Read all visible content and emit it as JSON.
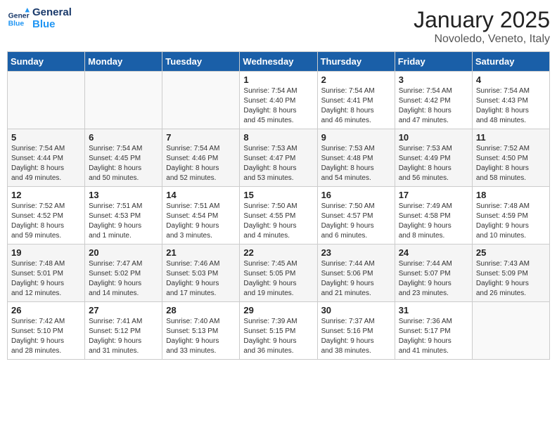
{
  "header": {
    "logo_line1": "General",
    "logo_line2": "Blue",
    "month": "January 2025",
    "location": "Novoledo, Veneto, Italy"
  },
  "weekdays": [
    "Sunday",
    "Monday",
    "Tuesday",
    "Wednesday",
    "Thursday",
    "Friday",
    "Saturday"
  ],
  "weeks": [
    [
      {
        "day": "",
        "info": ""
      },
      {
        "day": "",
        "info": ""
      },
      {
        "day": "",
        "info": ""
      },
      {
        "day": "1",
        "info": "Sunrise: 7:54 AM\nSunset: 4:40 PM\nDaylight: 8 hours\nand 45 minutes."
      },
      {
        "day": "2",
        "info": "Sunrise: 7:54 AM\nSunset: 4:41 PM\nDaylight: 8 hours\nand 46 minutes."
      },
      {
        "day": "3",
        "info": "Sunrise: 7:54 AM\nSunset: 4:42 PM\nDaylight: 8 hours\nand 47 minutes."
      },
      {
        "day": "4",
        "info": "Sunrise: 7:54 AM\nSunset: 4:43 PM\nDaylight: 8 hours\nand 48 minutes."
      }
    ],
    [
      {
        "day": "5",
        "info": "Sunrise: 7:54 AM\nSunset: 4:44 PM\nDaylight: 8 hours\nand 49 minutes."
      },
      {
        "day": "6",
        "info": "Sunrise: 7:54 AM\nSunset: 4:45 PM\nDaylight: 8 hours\nand 50 minutes."
      },
      {
        "day": "7",
        "info": "Sunrise: 7:54 AM\nSunset: 4:46 PM\nDaylight: 8 hours\nand 52 minutes."
      },
      {
        "day": "8",
        "info": "Sunrise: 7:53 AM\nSunset: 4:47 PM\nDaylight: 8 hours\nand 53 minutes."
      },
      {
        "day": "9",
        "info": "Sunrise: 7:53 AM\nSunset: 4:48 PM\nDaylight: 8 hours\nand 54 minutes."
      },
      {
        "day": "10",
        "info": "Sunrise: 7:53 AM\nSunset: 4:49 PM\nDaylight: 8 hours\nand 56 minutes."
      },
      {
        "day": "11",
        "info": "Sunrise: 7:52 AM\nSunset: 4:50 PM\nDaylight: 8 hours\nand 58 minutes."
      }
    ],
    [
      {
        "day": "12",
        "info": "Sunrise: 7:52 AM\nSunset: 4:52 PM\nDaylight: 8 hours\nand 59 minutes."
      },
      {
        "day": "13",
        "info": "Sunrise: 7:51 AM\nSunset: 4:53 PM\nDaylight: 9 hours\nand 1 minute."
      },
      {
        "day": "14",
        "info": "Sunrise: 7:51 AM\nSunset: 4:54 PM\nDaylight: 9 hours\nand 3 minutes."
      },
      {
        "day": "15",
        "info": "Sunrise: 7:50 AM\nSunset: 4:55 PM\nDaylight: 9 hours\nand 4 minutes."
      },
      {
        "day": "16",
        "info": "Sunrise: 7:50 AM\nSunset: 4:57 PM\nDaylight: 9 hours\nand 6 minutes."
      },
      {
        "day": "17",
        "info": "Sunrise: 7:49 AM\nSunset: 4:58 PM\nDaylight: 9 hours\nand 8 minutes."
      },
      {
        "day": "18",
        "info": "Sunrise: 7:48 AM\nSunset: 4:59 PM\nDaylight: 9 hours\nand 10 minutes."
      }
    ],
    [
      {
        "day": "19",
        "info": "Sunrise: 7:48 AM\nSunset: 5:01 PM\nDaylight: 9 hours\nand 12 minutes."
      },
      {
        "day": "20",
        "info": "Sunrise: 7:47 AM\nSunset: 5:02 PM\nDaylight: 9 hours\nand 14 minutes."
      },
      {
        "day": "21",
        "info": "Sunrise: 7:46 AM\nSunset: 5:03 PM\nDaylight: 9 hours\nand 17 minutes."
      },
      {
        "day": "22",
        "info": "Sunrise: 7:45 AM\nSunset: 5:05 PM\nDaylight: 9 hours\nand 19 minutes."
      },
      {
        "day": "23",
        "info": "Sunrise: 7:44 AM\nSunset: 5:06 PM\nDaylight: 9 hours\nand 21 minutes."
      },
      {
        "day": "24",
        "info": "Sunrise: 7:44 AM\nSunset: 5:07 PM\nDaylight: 9 hours\nand 23 minutes."
      },
      {
        "day": "25",
        "info": "Sunrise: 7:43 AM\nSunset: 5:09 PM\nDaylight: 9 hours\nand 26 minutes."
      }
    ],
    [
      {
        "day": "26",
        "info": "Sunrise: 7:42 AM\nSunset: 5:10 PM\nDaylight: 9 hours\nand 28 minutes."
      },
      {
        "day": "27",
        "info": "Sunrise: 7:41 AM\nSunset: 5:12 PM\nDaylight: 9 hours\nand 31 minutes."
      },
      {
        "day": "28",
        "info": "Sunrise: 7:40 AM\nSunset: 5:13 PM\nDaylight: 9 hours\nand 33 minutes."
      },
      {
        "day": "29",
        "info": "Sunrise: 7:39 AM\nSunset: 5:15 PM\nDaylight: 9 hours\nand 36 minutes."
      },
      {
        "day": "30",
        "info": "Sunrise: 7:37 AM\nSunset: 5:16 PM\nDaylight: 9 hours\nand 38 minutes."
      },
      {
        "day": "31",
        "info": "Sunrise: 7:36 AM\nSunset: 5:17 PM\nDaylight: 9 hours\nand 41 minutes."
      },
      {
        "day": "",
        "info": ""
      }
    ]
  ]
}
